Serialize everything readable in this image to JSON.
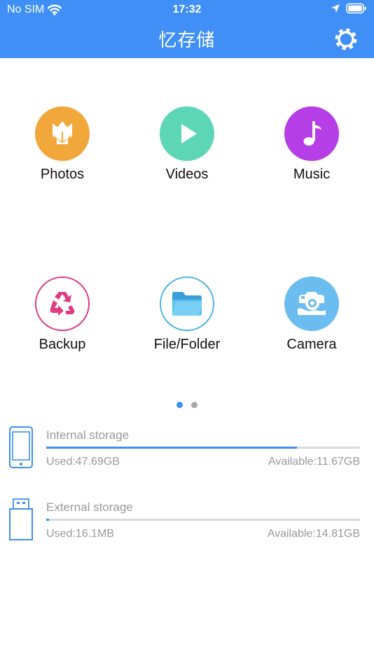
{
  "status_bar": {
    "carrier": "No SIM",
    "time": "17:32"
  },
  "header": {
    "title": "忆存储"
  },
  "colors": {
    "header_bg": "#3f8ff7",
    "accent": "#3f8ff7",
    "photos": "#f2a73b",
    "videos": "#5dd6b6",
    "music": "#b63ee6",
    "backup": "#e03b80",
    "file_folder": "#4fb3e6",
    "camera": "#6bbdf0"
  },
  "categories": [
    {
      "label": "Photos",
      "icon": "tulip-icon"
    },
    {
      "label": "Videos",
      "icon": "play-icon"
    },
    {
      "label": "Music",
      "icon": "music-note-icon"
    },
    {
      "label": "Backup",
      "icon": "recycle-icon"
    },
    {
      "label": "File/Folder",
      "icon": "folder-icon"
    },
    {
      "label": "Camera",
      "icon": "camera-icon"
    }
  ],
  "pager": {
    "pages": 2,
    "active_index": 0
  },
  "storage": {
    "internal": {
      "title": "Internal storage",
      "used": "Used:47.69GB",
      "available": "Available:11.67GB",
      "used_fraction": 0.8
    },
    "external": {
      "title": "External storage",
      "used": "Used:16.1MB",
      "available": "Available:14.81GB",
      "used_fraction": 0.01
    }
  }
}
